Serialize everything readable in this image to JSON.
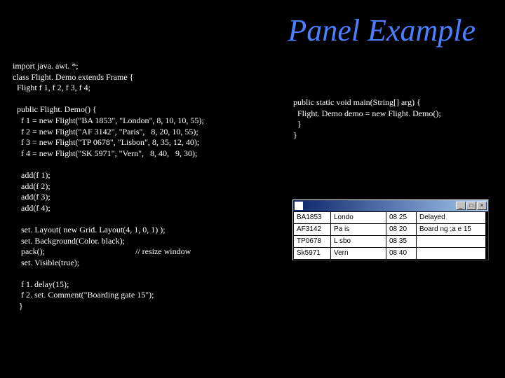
{
  "title": "Panel Example",
  "code_left": "import java. awt. *;\nclass Flight. Demo extends Frame {\n  Flight f 1, f 2, f 3, f 4;\n\n  public Flight. Demo() {\n    f 1 = new Flight(\"BA 1853\", \"London\", 8, 10, 10, 55);\n    f 2 = new Flight(\"AF 3142\", \"Paris\",   8, 20, 10, 55);\n    f 3 = new Flight(\"TP 0678\", \"Lisbon\", 8, 35, 12, 40);\n    f 4 = new Flight(\"SK 5971\", \"Vern\",   8, 40,   9, 30);\n\n    add(f 1);\n    add(f 2);\n    add(f 3);\n    add(f 4);\n\n    set. Layout( new Grid. Layout(4, 1, 0, 1) );\n    set. Background(Color. black);\n    pack();                                           // resize window\n    set. Visible(true);\n\n    f 1. delay(15);\n    f 2. set. Comment(\"Boarding gate 15\");\n   }",
  "code_right": "public static void main(String[] arg) {\n  Flight. Demo demo = new Flight. Demo();\n  }\n}",
  "window": {
    "buttons": {
      "min": "_",
      "max": "□",
      "close": "×"
    },
    "rows": [
      {
        "flight": "BA1853",
        "city": "Londo",
        "time": "08 25",
        "status": "Delayed"
      },
      {
        "flight": "AF3142",
        "city": "Pa is",
        "time": "08 20",
        "status": "Board ng ;a e 15"
      },
      {
        "flight": "TP0678",
        "city": "L sbo",
        "time": "08 35",
        "status": ""
      },
      {
        "flight": "Sk5971",
        "city": "Vern",
        "time": "08 40",
        "status": ""
      }
    ]
  }
}
